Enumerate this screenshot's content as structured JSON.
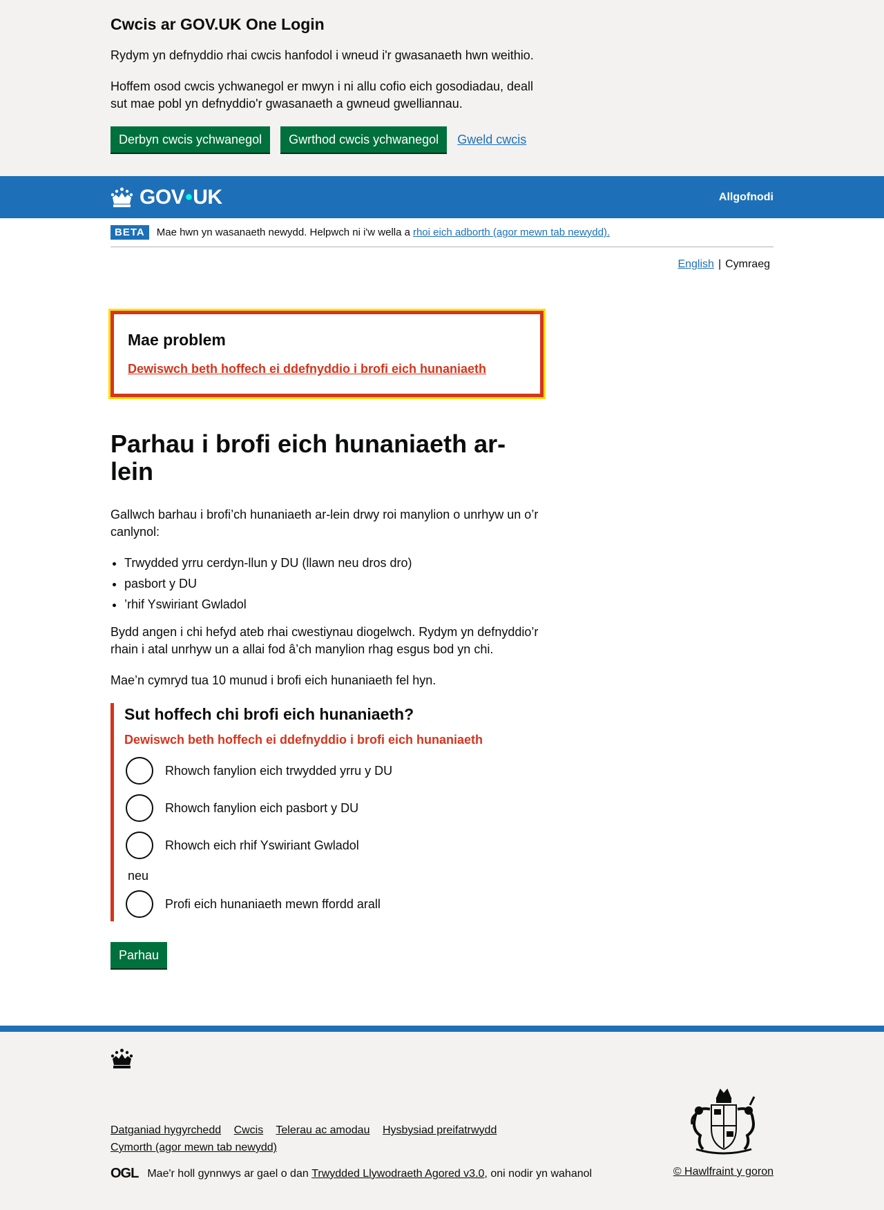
{
  "cookie_banner": {
    "title": "Cwcis ar GOV.UK One Login",
    "p1": "Rydym yn defnyddio rhai cwcis hanfodol i wneud i'r gwasanaeth hwn weithio.",
    "p2": "Hoffem osod cwcis ychwanegol er mwyn i ni allu cofio eich gosodiadau, deall sut mae pobl yn defnyddio'r gwasanaeth a gwneud gwelliannau.",
    "accept_label": "Derbyn cwcis ychwanegol",
    "reject_label": "Gwrthod cwcis ychwanegol",
    "view_label": "Gweld cwcis"
  },
  "header": {
    "logo_gov": "GOV",
    "logo_dot": "•",
    "logo_uk": "UK",
    "signout_label": "Allgofnodi"
  },
  "beta_banner": {
    "tag": "BETA",
    "text": "Mae hwn yn wasanaeth newydd. Helpwch ni i'w wella a",
    "link": "rhoi eich adborth (agor mewn tab newydd)."
  },
  "language": {
    "english": "English",
    "separator": "|",
    "welsh": "Cymraeg"
  },
  "error_summary": {
    "title": "Mae problem",
    "link": "Dewiswch beth hoffech ei ddefnyddio i brofi eich hunaniaeth"
  },
  "main": {
    "title": "Parhau i brofi eich hunaniaeth ar-lein",
    "intro": "Gallwch barhau i brofi’ch hunaniaeth ar-lein drwy roi manylion o unrhyw un o’r canlynol:",
    "bullets": [
      "Trwydded yrru cerdyn-llun y DU (llawn neu dros dro)",
      "pasbort y DU",
      "’rhif Yswiriant Gwladol"
    ],
    "p2": "Bydd angen i chi hefyd ateb rhai cwestiynau diogelwch. Rydym yn defnyddio’r rhain i atal unrhyw un a allai fod â’ch manylion rhag esgus bod yn chi.",
    "p3": "Mae’n cymryd tua 10 munud i brofi eich hunaniaeth fel hyn."
  },
  "question": {
    "legend": "Sut hoffech chi brofi eich hunaniaeth?",
    "error": "Dewiswch beth hoffech ei ddefnyddio i brofi eich hunaniaeth",
    "options": [
      "Rhowch fanylion eich trwydded yrru y DU",
      "Rhowch fanylion eich pasbort y DU",
      "Rhowch eich rhif Yswiriant Gwladol"
    ],
    "divider": "neu",
    "other_option": "Profi eich hunaniaeth mewn ffordd arall"
  },
  "continue_label": "Parhau",
  "footer": {
    "links": [
      "Datganiad hygyrchedd",
      "Cwcis",
      "Telerau ac amodau",
      "Hysbysiad preifatrwydd",
      "Cymorth (agor mewn tab newydd)"
    ],
    "ogl": "OGL",
    "licence_prefix": "Mae'r holl gynnwys ar gael o dan",
    "licence_link": "Trwydded Llywodraeth Agored v3.0",
    "licence_suffix": ", oni nodir yn wahanol",
    "copyright": "© Hawlfraint y goron"
  },
  "colors": {
    "brand_blue": "#1d70b8",
    "button_green": "#00703c",
    "error_red": "#d4351c",
    "focus_yellow": "#ffdd00"
  }
}
